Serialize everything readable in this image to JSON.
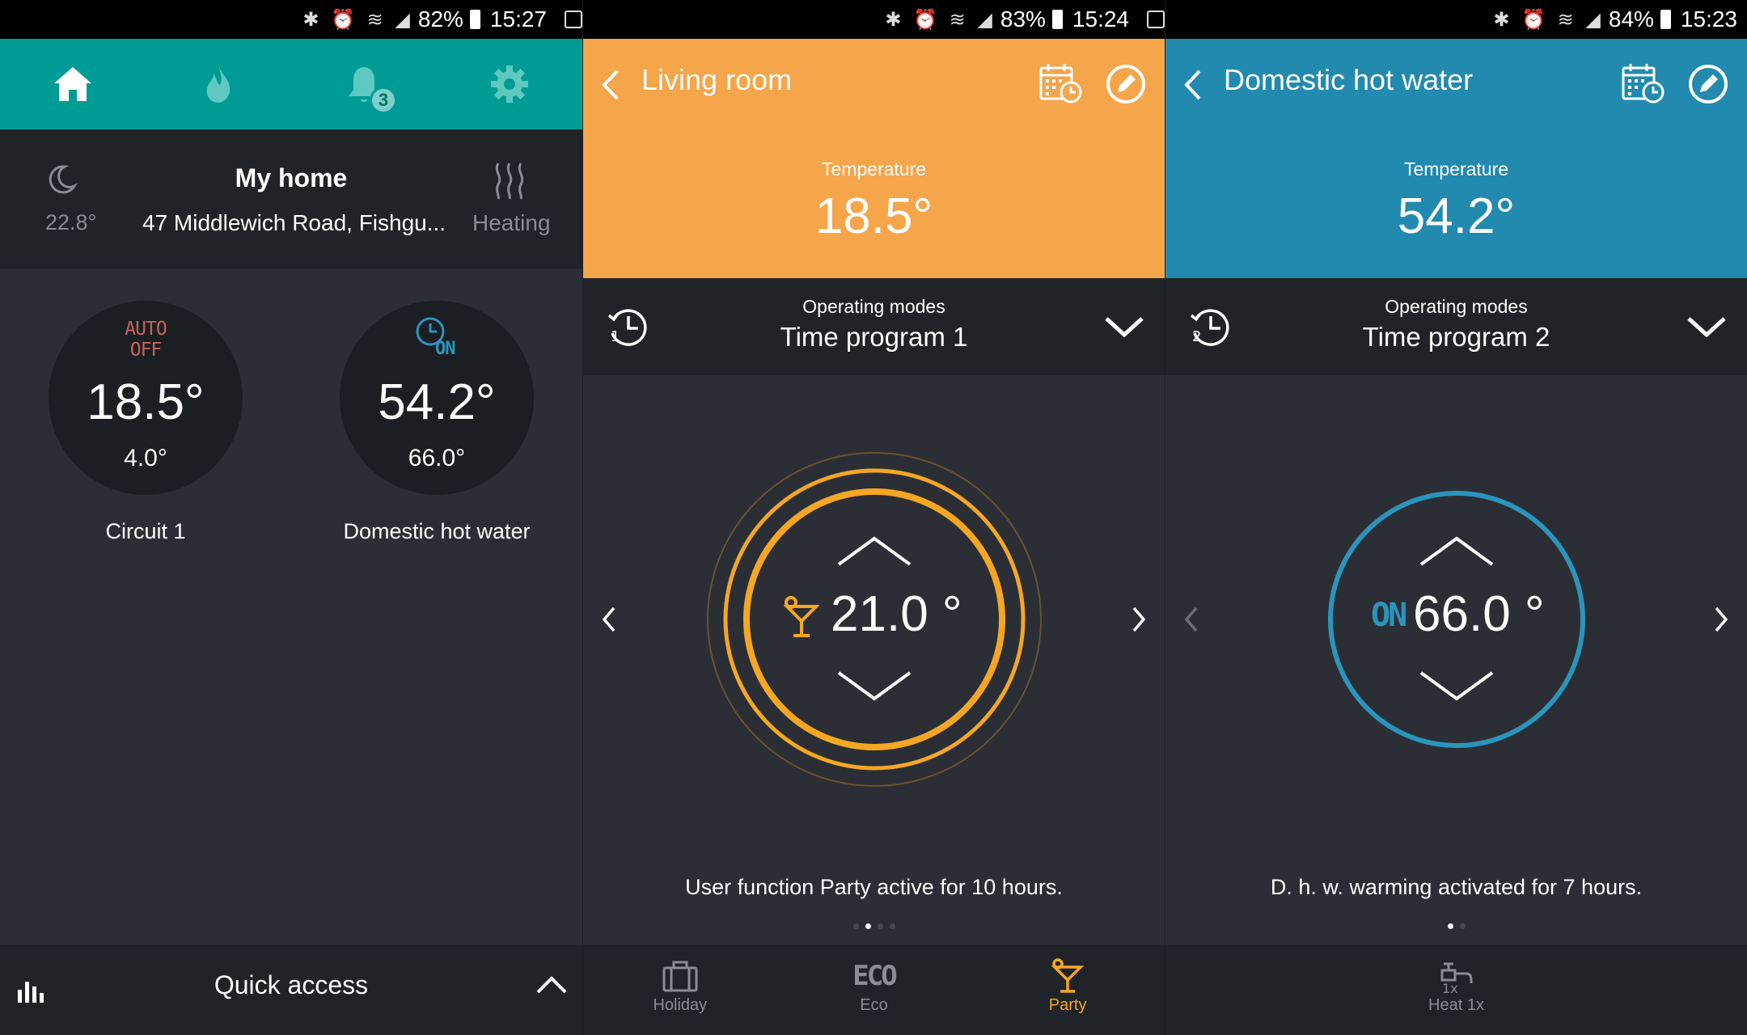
{
  "colors": {
    "teal": "#009b95",
    "orange": "#f5a54a",
    "blue": "#228aaf",
    "accent_orange": "#f5a623",
    "accent_blue": "#2a95bd",
    "dark_bg": "#2b2f35",
    "bar_bg": "#202328"
  },
  "panel1": {
    "status": {
      "battery": "82%",
      "time": "15:27"
    },
    "nav": [
      "home-icon",
      "flame-icon",
      "bell-icon",
      "gear-icon"
    ],
    "notifications_badge": "3",
    "home": {
      "outside_temp": "22.8°",
      "title": "My home",
      "address": "47 Middlewich Road, Fishgu...",
      "heating_label": "Heating"
    },
    "tiles": [
      {
        "mode_line1": "AUTO",
        "mode_line2": "OFF",
        "temp": "18.5°",
        "setpoint": "4.0°",
        "label": "Circuit 1"
      },
      {
        "mode_line1": "ON",
        "temp": "54.2°",
        "setpoint": "66.0°",
        "label": "Domestic hot water"
      }
    ],
    "quick_access": "Quick access"
  },
  "panel2": {
    "status": {
      "battery": "83%",
      "time": "15:24"
    },
    "title": "Living room",
    "temp_label": "Temperature",
    "temp_value": "18.5°",
    "modes_label": "Operating modes",
    "modes_value": "Time program 1",
    "setpoint": "21.0 °",
    "info": "User function Party active for 10 hours.",
    "bottom": [
      {
        "label": "Holiday",
        "icon": "suitcase-icon"
      },
      {
        "label": "Eco",
        "icon": "eco-icon",
        "icon_text": "ECO"
      },
      {
        "label": "Party",
        "icon": "cocktail-icon"
      }
    ]
  },
  "panel3": {
    "status": {
      "battery": "84%",
      "time": "15:23"
    },
    "title": "Domestic hot water",
    "temp_label": "Temperature",
    "temp_value": "54.2°",
    "modes_label": "Operating modes",
    "modes_value": "Time program 2",
    "on_label": "ON",
    "setpoint": "66.0 °",
    "info": "D. h. w. warming activated for 7 hours.",
    "bottom": [
      {
        "label": "Heat 1x",
        "icon": "tap-icon"
      }
    ]
  }
}
